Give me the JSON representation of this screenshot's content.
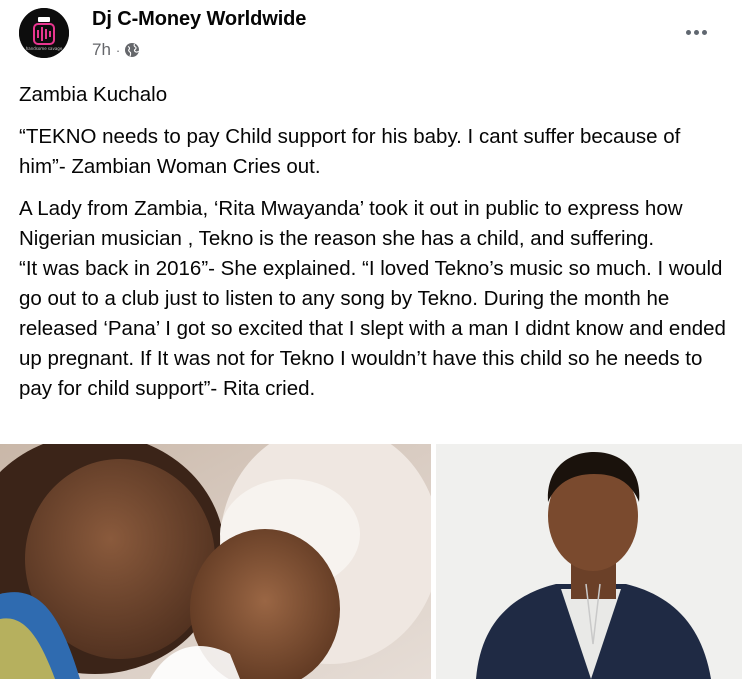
{
  "post": {
    "author": "Dj C-Money Worldwide",
    "time": "7h",
    "separator": "·",
    "privacy_icon": "globe-icon",
    "more_icon": "more-horizontal-icon",
    "avatar_caption": "handsome savage",
    "paragraphs": [
      "Zambia Kuchalo",
      "“TEKNO needs to pay Child support for his baby. I cant suffer because of him”- Zambian Woman Cries out.",
      "A Lady from Zambia, ‘Rita Mwayanda’ took it out in public to express how Nigerian musician , Tekno is the reason she has a child, and suffering.\n“It was back in 2016”- She explained. “I loved Tekno’s music so much. I would go out to a club just to listen to any song by Tekno. During the month he released ‘Pana’ I got so excited that I slept with a man I didnt know and ended up pregnant. If It was not for Tekno I wouldn’t have this child so he needs to pay for child support”- Rita cried."
    ]
  },
  "colors": {
    "text_primary": "#050505",
    "text_secondary": "#65676b",
    "avatar_accent": "#e8368f"
  }
}
